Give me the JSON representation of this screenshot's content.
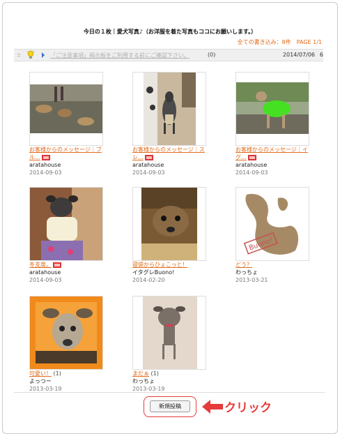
{
  "page": {
    "title": "今日の１枚｜愛犬写真♪（お洋服を着た写真もココにお願いします。）",
    "meta": "全ての書き込み：8件　PAGE 1/1"
  },
  "notice": {
    "link": "「ご注意事項」掲示板をご利用する前にご確認下さい。",
    "count": "(0)",
    "date": "2014/07/06",
    "page_num": "6"
  },
  "posts": [
    {
      "title": "お客様からのメッセージ｜ブル...",
      "count": "",
      "user": "aratahouse",
      "date": "2014-09-03",
      "new": true
    },
    {
      "title": "お客様からのメッセージ｜スレ...",
      "count": "",
      "user": "aratahouse",
      "date": "2014-09-03",
      "new": true
    },
    {
      "title": "お客様からのメッセージ｜イグ...",
      "count": "",
      "user": "aratahouse",
      "date": "2014-09-03",
      "new": true
    },
    {
      "title": "冬支度。",
      "count": "",
      "user": "aratahouse",
      "date": "2014-09-03",
      "new": true
    },
    {
      "title": "寝袋からひょこっと！",
      "count": "",
      "user": "イタグレBuono!",
      "date": "2014-02-20",
      "new": false
    },
    {
      "title": "どう？",
      "count": "",
      "user": "わっちょ",
      "date": "2013-03-21",
      "new": false
    },
    {
      "title": "可愛い！",
      "count": "(1)",
      "user": "よっつー",
      "date": "2013-03-19",
      "new": false
    },
    {
      "title": "まだぁ",
      "count": "(1)",
      "user": "わっちょ",
      "date": "2013-03-19",
      "new": false
    }
  ],
  "image_stamp": "Buono!",
  "actions": {
    "new_post": "新規投稿",
    "click_label": "クリック"
  },
  "colors": {
    "accent": "#e26b1a",
    "highlight": "#e53b3b"
  }
}
